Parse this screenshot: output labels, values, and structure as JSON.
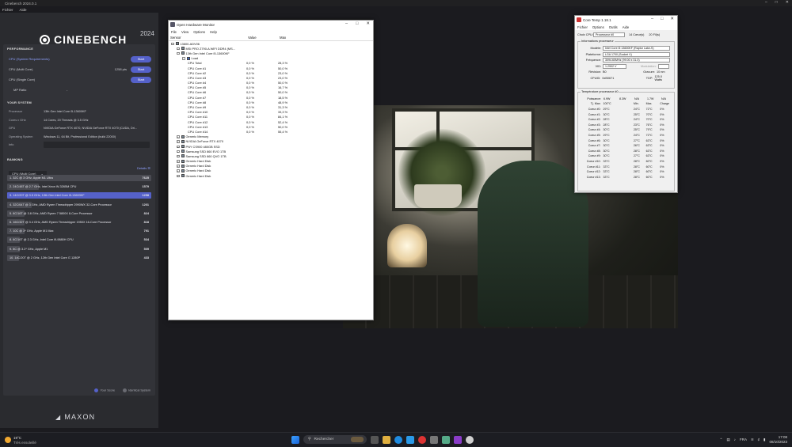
{
  "cinebench": {
    "window_title": "Cinebench 2024.0.1",
    "menu": [
      "Fichier",
      "Aide"
    ],
    "brand": "CINEBENCH",
    "year": "2024",
    "performance": {
      "heading": "PERFORMANCE",
      "rows": [
        {
          "label": "CPU (System Requirements)",
          "value": "",
          "button": "Start"
        },
        {
          "label": "CPU (Multi Core)",
          "value": "1258 pts",
          "button": "Start"
        },
        {
          "label": "CPU (Single Core)",
          "value": "",
          "button": "Start"
        },
        {
          "label": "MP Ratio",
          "value": "-",
          "button": ""
        }
      ]
    },
    "system": {
      "heading": "YOUR SYSTEM",
      "rows": [
        {
          "key": "Processor",
          "value": "13th Gen Intel Core i5-13600KF"
        },
        {
          "key": "Cores x GHz",
          "value": "14 Cores, 20 Threads @ 3.5 GHz"
        },
        {
          "key": "GPU",
          "value": "NVIDIA GeForce RTX 4070, NVIDIA GeForce RTX 4070 (CUDA, Dri..."
        },
        {
          "key": "Operating System",
          "value": "Windows 11, 64 Bit, Professional Edition (build 22000)"
        },
        {
          "key": "Info",
          "value": ""
        }
      ]
    },
    "ranking": {
      "heading": "RANKING",
      "selector": "CPU (Multi Core)",
      "details": "Details",
      "rows": [
        {
          "label": "1. 32C @ 3 GHz, Apple M1 Ultra",
          "score": "7625"
        },
        {
          "label": "2. 24C/48T @ 2.7 GHz, Intel Xeon W-3265M CPU",
          "score": "1579"
        },
        {
          "label": "3. 14C/20T @ 3.5 GHz, 13th Gen Intel Core i5-13600KF",
          "score": "1258"
        },
        {
          "label": "4. 32C/64T @ 3 GHz, AMD Ryzen Threadripper 2990WX 32-Core Processor",
          "score": "1201"
        },
        {
          "label": "5. 8C/16T @ 3.8 GHz, AMD Ryzen 7 5800X 8-Core Processor",
          "score": "824"
        },
        {
          "label": "6. 16C/32T @ 3.4 GHz, AMD Ryzen Threadripper 1950X 16-Core Processor",
          "score": "818"
        },
        {
          "label": "7. 10C @ 3* GHz, Apple M1 Max",
          "score": "791"
        },
        {
          "label": "8. 8C/16T @ 2.3 GHz, Intel Core i9-9880H CPU",
          "score": "534"
        },
        {
          "label": "9. 8C @ 3.2* GHz, Apple M1",
          "score": "509"
        },
        {
          "label": "10. 14C/20T @ 2 GHz, 12th Gen Intel Core i7-1280P",
          "score": "433"
        }
      ],
      "bar_fraction": [
        1.0,
        0.22,
        1.0,
        0.17,
        0.12,
        0.12,
        0.12,
        0.09,
        0.09,
        0.08
      ],
      "legend": {
        "your_score": "Your Score",
        "identical": "Identical System"
      }
    },
    "maxon": "MAXON"
  },
  "ohm": {
    "title": "Open Hardware Monitor",
    "menu": [
      "File",
      "View",
      "Options",
      "Help"
    ],
    "columns": [
      "Sensor",
      "Value",
      "Max"
    ],
    "rows": [
      {
        "indent": 0,
        "exp": "-",
        "label": "13600-ADV06",
        "value": "",
        "max": ""
      },
      {
        "indent": 1,
        "exp": "-",
        "label": "MSI PRO Z790-A WIFI DDR4 (MS...",
        "value": "",
        "max": ""
      },
      {
        "indent": 1,
        "exp": "-",
        "label": "13th Gen Intel Core i5-13600KF",
        "value": "",
        "max": ""
      },
      {
        "indent": 2,
        "exp": "-",
        "label": "Load",
        "value": "",
        "max": ""
      },
      {
        "indent": 3,
        "exp": "",
        "label": "CPU Total",
        "value": "0,0 %",
        "max": "28,3 %"
      },
      {
        "indent": 3,
        "exp": "",
        "label": "CPU Core #1",
        "value": "0,0 %",
        "max": "50,0 %"
      },
      {
        "indent": 3,
        "exp": "",
        "label": "CPU Core #2",
        "value": "0,0 %",
        "max": "23,0 %"
      },
      {
        "indent": 3,
        "exp": "",
        "label": "CPU Core #3",
        "value": "0,0 %",
        "max": "23,0 %"
      },
      {
        "indent": 3,
        "exp": "",
        "label": "CPU Core #4",
        "value": "0,0 %",
        "max": "50,0 %"
      },
      {
        "indent": 3,
        "exp": "",
        "label": "CPU Core #5",
        "value": "0,0 %",
        "max": "16,7 %"
      },
      {
        "indent": 3,
        "exp": "",
        "label": "CPU Core #6",
        "value": "0,0 %",
        "max": "50,0 %"
      },
      {
        "indent": 3,
        "exp": "",
        "label": "CPU Core #7",
        "value": "0,0 %",
        "max": "18,5 %"
      },
      {
        "indent": 3,
        "exp": "",
        "label": "CPU Core #8",
        "value": "0,0 %",
        "max": "48,9 %"
      },
      {
        "indent": 3,
        "exp": "",
        "label": "CPU Core #9",
        "value": "0,0 %",
        "max": "31,3 %"
      },
      {
        "indent": 3,
        "exp": "",
        "label": "CPU Core #10",
        "value": "0,0 %",
        "max": "33,3 %"
      },
      {
        "indent": 3,
        "exp": "",
        "label": "CPU Core #11",
        "value": "0,0 %",
        "max": "84,1 %"
      },
      {
        "indent": 3,
        "exp": "",
        "label": "CPU Core #12",
        "value": "0,0 %",
        "max": "52,4 %"
      },
      {
        "indent": 3,
        "exp": "",
        "label": "CPU Core #13",
        "value": "0,0 %",
        "max": "50,0 %"
      },
      {
        "indent": 3,
        "exp": "",
        "label": "CPU Core #14",
        "value": "0,0 %",
        "max": "55,4 %"
      },
      {
        "indent": 1,
        "exp": "+",
        "label": "Generic Memory",
        "value": "",
        "max": ""
      },
      {
        "indent": 1,
        "exp": "+",
        "label": "NVIDIA GeForce RTX 4070",
        "value": "",
        "max": ""
      },
      {
        "indent": 1,
        "exp": "+",
        "label": "PNY CS900 480GB SSD",
        "value": "",
        "max": ""
      },
      {
        "indent": 1,
        "exp": "+",
        "label": "Samsung SSD 860 EVO 1TB",
        "value": "",
        "max": ""
      },
      {
        "indent": 1,
        "exp": "+",
        "label": "Samsung SSD 860 QVO 1TB",
        "value": "",
        "max": ""
      },
      {
        "indent": 1,
        "exp": "+",
        "label": "Generic Hard Disk",
        "value": "",
        "max": ""
      },
      {
        "indent": 1,
        "exp": "+",
        "label": "Generic Hard Disk",
        "value": "",
        "max": ""
      },
      {
        "indent": 1,
        "exp": "+",
        "label": "Generic Hard Disk",
        "value": "",
        "max": ""
      },
      {
        "indent": 1,
        "exp": "+",
        "label": "Generic Hard Disk",
        "value": "",
        "max": ""
      }
    ]
  },
  "coretemp": {
    "title": "Core Temp 1.18.1",
    "menu": [
      "Fichier",
      "Options",
      "Outils",
      "Aide"
    ],
    "choix_cpu_label": "Choix CPU:",
    "choix_cpu_value": "Processeur #0",
    "cores_info": "14 Cœur(s)",
    "threads_info": "20 Fil(s)",
    "info_group": "Informations processeur",
    "modele_label": "Modèle:",
    "modele": "Intel Core i5 13600KF (Raptor Lake-S)",
    "plateforme_label": "Plateforme:",
    "plateforme": "LGA 1700 (Socket V)",
    "frequence_label": "Fréquence:",
    "frequence": "3094.60MHz (99.00 x 31.0)",
    "vid_label": "VID:",
    "vid": "1.2902 V",
    "modulation_label": "Modulation:",
    "revision_label": "Révision:",
    "revision": "B0",
    "gravure_label": "Gravure:",
    "gravure": "10 nm",
    "cpuid_label": "CPUID:",
    "cpuid": "0xB0671",
    "tdp_label": "TDP:",
    "tdp": "125.0 Watts",
    "temp_group": "Température processeur #0",
    "puissance_label": "Puissance:",
    "puissance": [
      "6.9W",
      "8.3W",
      "N/A",
      "1.7W",
      "N/A"
    ],
    "tj_label": "Tj. Max:",
    "tj": "100°C",
    "col_min": "Min.",
    "col_max": "Max.",
    "col_charge": "Charge",
    "cores": [
      {
        "name": "Coeur #0:",
        "temp": "29°C",
        "min": "24°C",
        "max": "72°C",
        "load": "0%"
      },
      {
        "name": "Coeur #1:",
        "temp": "30°C",
        "min": "25°C",
        "max": "70°C",
        "load": "0%"
      },
      {
        "name": "Coeur #2:",
        "temp": "28°C",
        "min": "24°C",
        "max": "70°C",
        "load": "0%"
      },
      {
        "name": "Coeur #3:",
        "temp": "28°C",
        "min": "23°C",
        "max": "76°C",
        "load": "0%"
      },
      {
        "name": "Coeur #4:",
        "temp": "30°C",
        "min": "25°C",
        "max": "79°C",
        "load": "0%"
      },
      {
        "name": "Coeur #5:",
        "temp": "29°C",
        "min": "24°C",
        "max": "72°C",
        "load": "0%"
      },
      {
        "name": "Coeur #6:",
        "temp": "30°C",
        "min": "27°C",
        "max": "63°C",
        "load": "0%"
      },
      {
        "name": "Coeur #7:",
        "temp": "30°C",
        "min": "26°C",
        "max": "63°C",
        "load": "0%"
      },
      {
        "name": "Coeur #8:",
        "temp": "30°C",
        "min": "28°C",
        "max": "63°C",
        "load": "0%"
      },
      {
        "name": "Coeur #9:",
        "temp": "30°C",
        "min": "27°C",
        "max": "63°C",
        "load": "0%"
      },
      {
        "name": "Coeur #10:",
        "temp": "33°C",
        "min": "28°C",
        "max": "60°C",
        "load": "0%"
      },
      {
        "name": "Coeur #11:",
        "temp": "33°C",
        "min": "28°C",
        "max": "60°C",
        "load": "0%"
      },
      {
        "name": "Coeur #12:",
        "temp": "33°C",
        "min": "28°C",
        "max": "60°C",
        "load": "0%"
      },
      {
        "name": "Coeur #13:",
        "temp": "33°C",
        "min": "28°C",
        "max": "60°C",
        "load": "0%"
      }
    ]
  },
  "taskbar": {
    "weather_temp": "19°C",
    "weather_desc": "Très ensoleillé",
    "search_placeholder": "Rechercher",
    "lang": "FRA",
    "time": "17:08",
    "date": "08/10/2023"
  }
}
